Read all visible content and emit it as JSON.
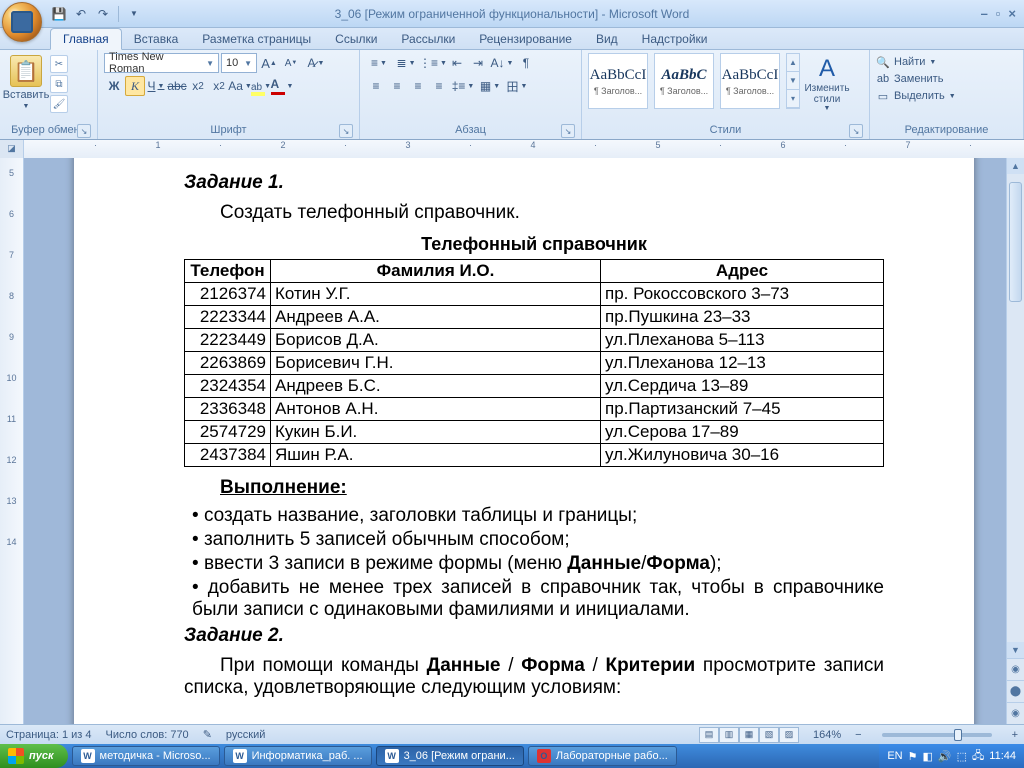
{
  "window": {
    "title": "3_06 [Режим ограниченной функциональности] - Microsoft Word"
  },
  "tabs": [
    "Главная",
    "Вставка",
    "Разметка страницы",
    "Ссылки",
    "Рассылки",
    "Рецензирование",
    "Вид",
    "Надстройки"
  ],
  "ribbon": {
    "clipboard": {
      "label": "Буфер обмена",
      "paste": "Вставить"
    },
    "font": {
      "label": "Шрифт",
      "name": "Times New Roman",
      "size": "10"
    },
    "paragraph": {
      "label": "Абзац"
    },
    "styles": {
      "label": "Стили",
      "items": [
        {
          "sample": "AaBbCcI",
          "name": "¶ Заголов..."
        },
        {
          "sample": "AaBbC",
          "name": "¶ Заголов..."
        },
        {
          "sample": "AaBbCcI",
          "name": "¶ Заголов..."
        }
      ],
      "change": "Изменить стили"
    },
    "editing": {
      "label": "Редактирование",
      "find": "Найти",
      "replace": "Заменить",
      "select": "Выделить"
    }
  },
  "document": {
    "task1_heading": "Задание 1.",
    "task1_body": "Создать телефонный справочник.",
    "table_title": "Телефонный справочник",
    "table_headers": [
      "Телефон",
      "Фамилия И.О.",
      "Адрес"
    ],
    "table_rows": [
      [
        "2126374",
        "Котин У.Г.",
        "пр. Рокоссовского 3–73"
      ],
      [
        "2223344",
        "Андреев А.А.",
        "пр.Пушкина 23–33"
      ],
      [
        "2223449",
        "Борисов Д.А.",
        "ул.Плеханова 5–113"
      ],
      [
        "2263869",
        "Борисевич Г.Н.",
        "ул.Плеханова 12–13"
      ],
      [
        "2324354",
        "Андреев Б.С.",
        "ул.Сердича 13–89"
      ],
      [
        "2336348",
        "Антонов А.Н.",
        "пр.Партизанский 7–45"
      ],
      [
        "2574729",
        "Кукин Б.И.",
        "ул.Серова 17–89"
      ],
      [
        "2437384",
        "Яшин Р.А.",
        "ул.Жилуновича 30–16"
      ]
    ],
    "subheading": "Выполнение:",
    "bullets": [
      "создать название, заголовки таблицы и границы;",
      "заполнить 5 записей обычным способом;",
      " ввести 3 записи  в режиме формы (меню <b>Данные</b>/<b>Форма</b>);",
      " добавить не менее трех записей в справочник так, чтобы в справоч­нике были записи с одинаковыми фамилиями и инициалами."
    ],
    "task2_heading": "Задание 2.",
    "task2_body": "При помощи команды <b>Данные</b> / <b>Форма</b> / <b>Критерии</b> просмотрите записи списка, удовлетворяющие следующим условиям:"
  },
  "status": {
    "page": "Страница: 1 из 4",
    "words": "Число слов: 770",
    "lang": "русский",
    "zoom": "164%"
  },
  "taskbar": {
    "start": "пуск",
    "tasks": [
      {
        "label": "методичка - Microso..."
      },
      {
        "label": "Информатика_раб. ..."
      },
      {
        "label": "3_06 [Режим ограни...",
        "active": true
      },
      {
        "label": "Лабораторные рабо..."
      }
    ],
    "lang": "EN",
    "time": "11:44"
  }
}
